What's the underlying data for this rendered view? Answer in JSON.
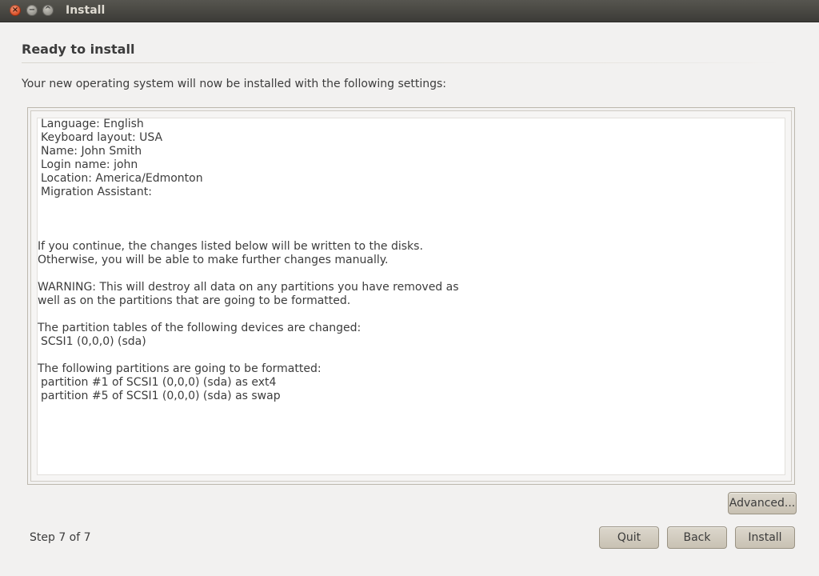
{
  "window": {
    "title": "Install",
    "controls": {
      "close_glyph": "×",
      "minimize_glyph": "−",
      "maximize_glyph": "^"
    }
  },
  "page": {
    "heading": "Ready to install",
    "subtitle": "Your new operating system will now be installed with the following settings:"
  },
  "summary": {
    "settings": [
      "Language: English",
      "Keyboard layout: USA",
      "Name: John Smith",
      "Login name: john",
      "Location: America/Edmonton",
      "Migration Assistant:"
    ],
    "notice_1": "If you continue, the changes listed below will be written to the disks.",
    "notice_2": "Otherwise, you will be able to make further changes manually.",
    "warning_1": "WARNING: This will destroy all data on any partitions you have removed as",
    "warning_2": "well as on the partitions that are going to be formatted.",
    "partition_tables_heading": "The partition tables of the following devices are changed:",
    "partition_tables": [
      "SCSI1 (0,0,0) (sda)"
    ],
    "format_heading": "The following partitions are going to be formatted:",
    "format_list": [
      "partition #1 of SCSI1 (0,0,0) (sda) as ext4",
      "partition #5 of SCSI1 (0,0,0) (sda) as swap"
    ]
  },
  "footer": {
    "step_text": "Step 7 of 7",
    "advanced_label": "Advanced...",
    "quit_label": "Quit",
    "back_label": "Back",
    "install_label": "Install"
  },
  "colors": {
    "background": "#f2f1f0",
    "titlebar": "#3c3b37",
    "close_button": "#d7461e",
    "button": "#c8c1b3"
  }
}
